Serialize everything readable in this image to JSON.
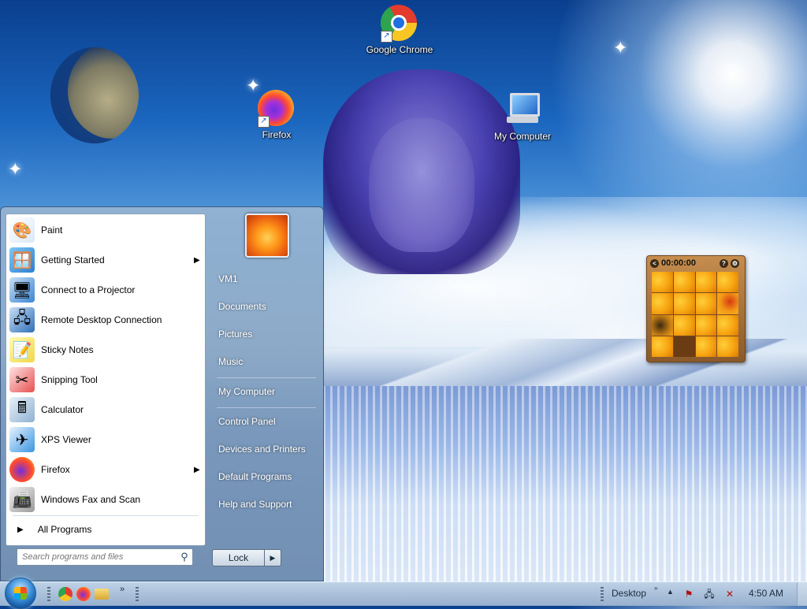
{
  "desktop": {
    "icons": [
      {
        "label": "Google Chrome",
        "icon": "chrome-icon"
      },
      {
        "label": "Firefox",
        "icon": "firefox-icon"
      },
      {
        "label": "My Computer",
        "icon": "computer-icon"
      }
    ]
  },
  "puzzle_gadget": {
    "timer": "00:00:00",
    "help": "?",
    "back": "<",
    "settings": "⚙"
  },
  "start_menu": {
    "programs": [
      {
        "label": "Paint",
        "icon": "paint-icon",
        "has_submenu": false
      },
      {
        "label": "Getting Started",
        "icon": "getting-started-icon",
        "has_submenu": true
      },
      {
        "label": "Connect to a Projector",
        "icon": "projector-icon",
        "has_submenu": false
      },
      {
        "label": "Remote Desktop Connection",
        "icon": "remote-desktop-icon",
        "has_submenu": false
      },
      {
        "label": "Sticky Notes",
        "icon": "sticky-notes-icon",
        "has_submenu": false
      },
      {
        "label": "Snipping Tool",
        "icon": "snipping-tool-icon",
        "has_submenu": false
      },
      {
        "label": "Calculator",
        "icon": "calculator-icon",
        "has_submenu": false
      },
      {
        "label": "XPS Viewer",
        "icon": "xps-viewer-icon",
        "has_submenu": false
      },
      {
        "label": "Firefox",
        "icon": "firefox-icon",
        "has_submenu": true
      },
      {
        "label": "Windows Fax and Scan",
        "icon": "fax-scan-icon",
        "has_submenu": false
      }
    ],
    "all_programs": "All Programs",
    "search_placeholder": "Search programs and files",
    "right_items": [
      {
        "label": "VM1"
      },
      {
        "label": "Documents"
      },
      {
        "label": "Pictures"
      },
      {
        "label": "Music"
      },
      {
        "label": "My Computer"
      },
      {
        "label": "Control Panel"
      },
      {
        "label": "Devices and Printers"
      },
      {
        "label": "Default Programs"
      },
      {
        "label": "Help and Support"
      }
    ],
    "lock_label": "Lock"
  },
  "taskbar": {
    "desktop_label": "Desktop",
    "clock": "4:50 AM",
    "overflow": "»",
    "tray_arrow": "▲"
  }
}
